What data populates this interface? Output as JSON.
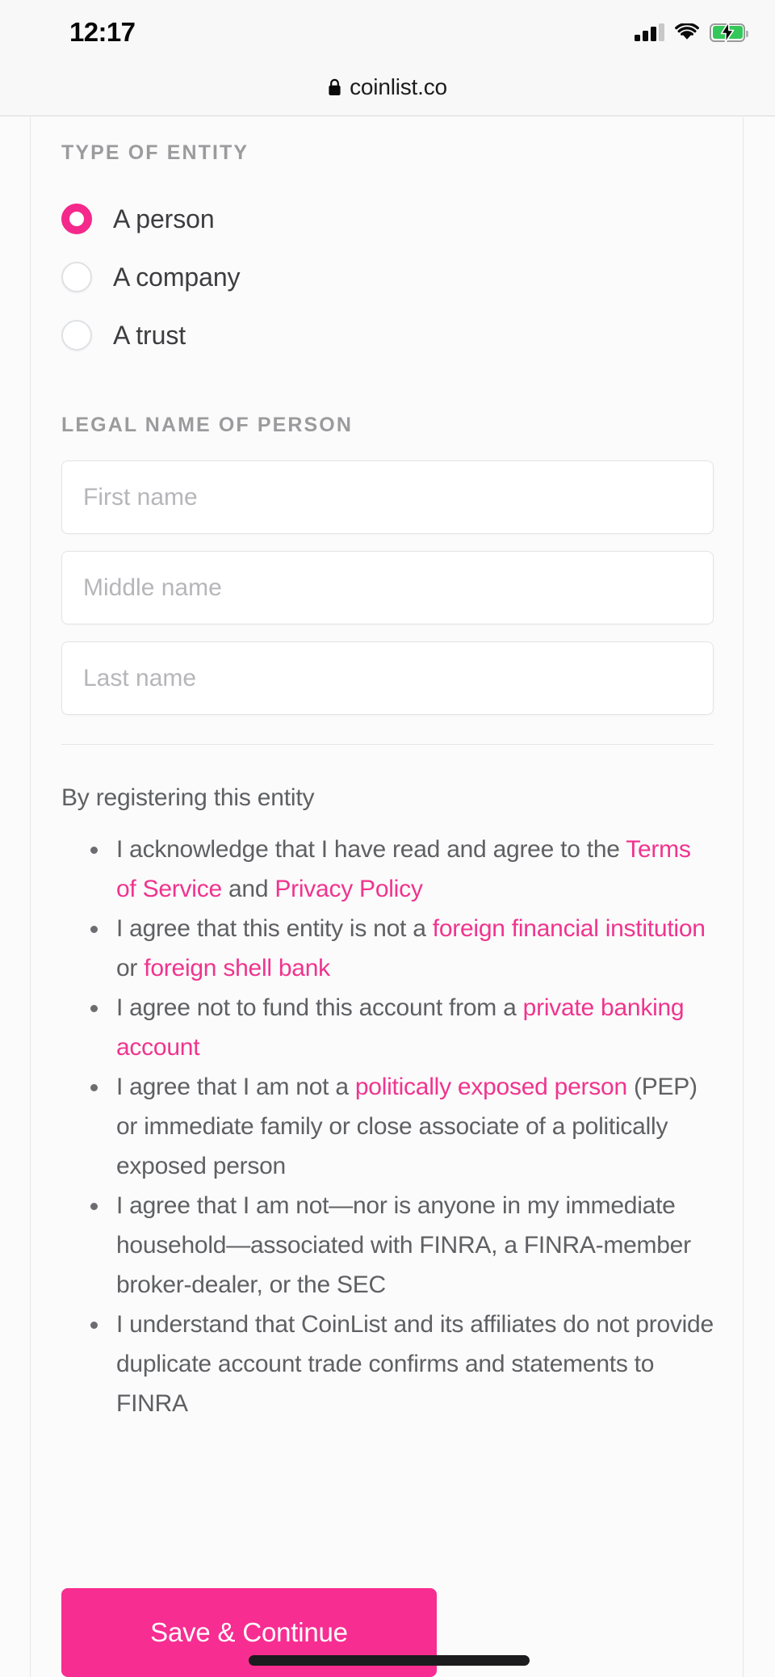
{
  "status_bar": {
    "time": "12:17",
    "signal_icon": "cellular-signal-icon",
    "wifi_icon": "wifi-icon",
    "battery_icon": "battery-charging-icon",
    "battery_color": "#34c759"
  },
  "browser": {
    "lock_icon": "lock-icon",
    "url": "coinlist.co"
  },
  "form": {
    "entity_section_label": "TYPE OF ENTITY",
    "entity_options": [
      {
        "label": "A person",
        "selected": true
      },
      {
        "label": "A company",
        "selected": false
      },
      {
        "label": "A trust",
        "selected": false
      }
    ],
    "name_section_label": "LEGAL NAME OF PERSON",
    "fields": [
      {
        "name": "first-name",
        "placeholder": "First name",
        "value": ""
      },
      {
        "name": "middle-name",
        "placeholder": "Middle name",
        "value": ""
      },
      {
        "name": "last-name",
        "placeholder": "Last name",
        "value": ""
      }
    ]
  },
  "agreements": {
    "intro": "By registering this entity",
    "items": [
      {
        "parts": [
          {
            "t": "I acknowledge that I have read and agree to the ",
            "link": false
          },
          {
            "t": "Terms of Service",
            "link": true
          },
          {
            "t": " and ",
            "link": false
          },
          {
            "t": "Privacy Policy",
            "link": true
          }
        ]
      },
      {
        "parts": [
          {
            "t": "I agree that this entity is not a ",
            "link": false
          },
          {
            "t": "foreign financial institution",
            "link": true
          },
          {
            "t": " or ",
            "link": false
          },
          {
            "t": "foreign shell bank",
            "link": true
          }
        ]
      },
      {
        "parts": [
          {
            "t": "I agree not to fund this account from a ",
            "link": false
          },
          {
            "t": "private banking account",
            "link": true
          }
        ]
      },
      {
        "parts": [
          {
            "t": "I agree that I am not a ",
            "link": false
          },
          {
            "t": "politically exposed person",
            "link": true
          },
          {
            "t": " (PEP) or immediate family or close associate of a politically exposed person",
            "link": false
          }
        ]
      },
      {
        "parts": [
          {
            "t": "I agree that I am not—nor is anyone in my immediate household—associated with FINRA, a FINRA-member broker-dealer, or the SEC",
            "link": false
          }
        ]
      },
      {
        "parts": [
          {
            "t": "I understand that CoinList and its affiliates do not provide duplicate account trade confirms and statements to FINRA",
            "link": false
          }
        ]
      }
    ]
  },
  "actions": {
    "save_continue_label": "Save & Continue"
  },
  "colors": {
    "accent_pink": "#f72d91",
    "link_pink": "#f0348e",
    "label_gray": "#9b9b9d",
    "body_gray": "#5f6063"
  }
}
